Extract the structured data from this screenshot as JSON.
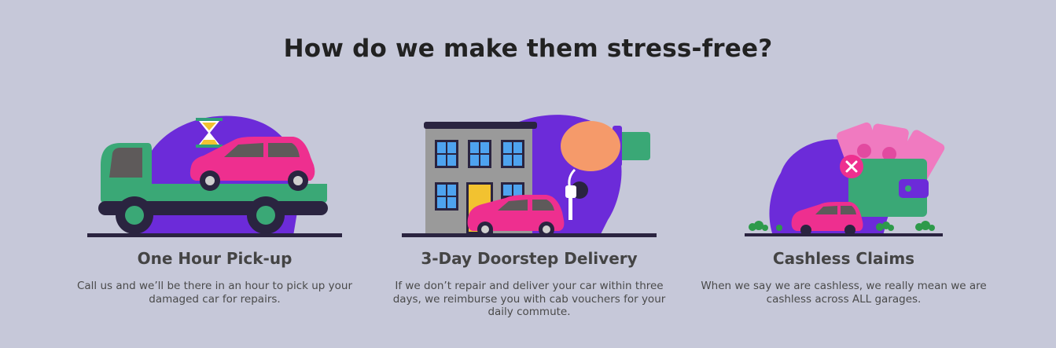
{
  "section": {
    "title": "How do we make them stress-free?"
  },
  "features": [
    {
      "title": "One Hour Pick-up",
      "description": "Call us and we’ll be there in an hour to pick up your damaged car for repairs.",
      "illustration": "tow-truck-icon"
    },
    {
      "title": "3-Day Doorstep Delivery",
      "description": "If we don’t repair and deliver your car within three days, we reimburse you with cab vouchers for your daily commute.",
      "illustration": "doorstep-delivery-icon"
    },
    {
      "title": "Cashless Claims",
      "description": "When we say we are cashless, we really mean we are cashless across ALL garages.",
      "illustration": "cashless-wallet-icon"
    }
  ],
  "colors": {
    "background": "#c6c8d9",
    "accent_purple": "#6c2bd9",
    "car_pink": "#ee2f8f",
    "truck_green": "#3aa876",
    "ground_dark": "#2a2440"
  }
}
